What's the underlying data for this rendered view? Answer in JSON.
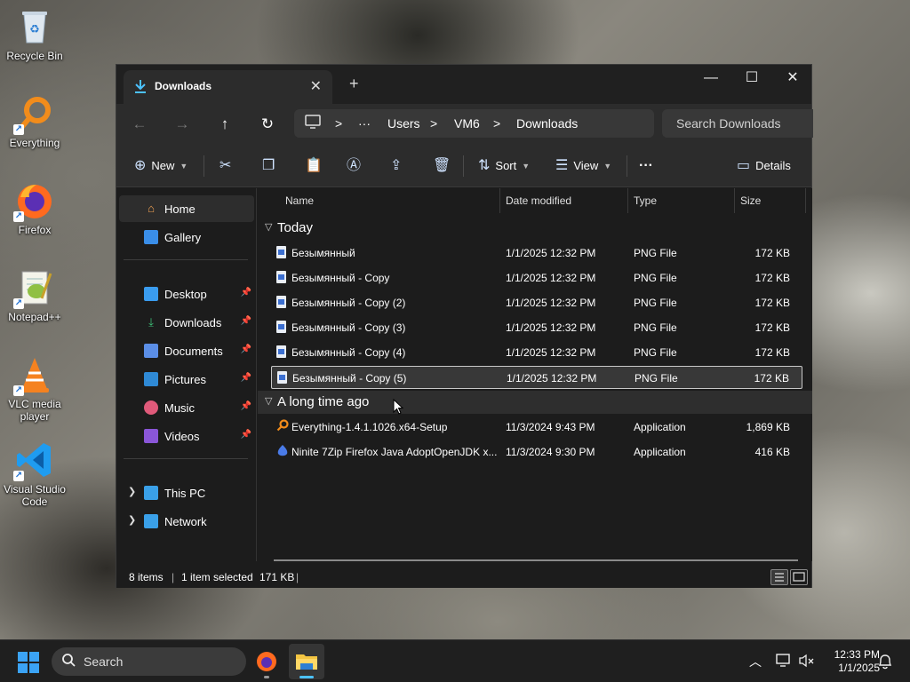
{
  "desktop": {
    "icons": [
      {
        "label": "Recycle Bin",
        "icon": "recycle-bin-icon"
      },
      {
        "label": "Everything",
        "icon": "everything-search-icon"
      },
      {
        "label": "Firefox",
        "icon": "firefox-icon"
      },
      {
        "label": "Notepad++",
        "icon": "notepadpp-icon"
      },
      {
        "label": "VLC media player",
        "icon": "vlc-icon"
      },
      {
        "label": "Visual Studio Code",
        "icon": "vscode-icon"
      }
    ]
  },
  "window": {
    "tab_title": "Downloads",
    "new_tab": "+",
    "controls": {
      "minimize": "—",
      "maximize": "☐",
      "close": "✕"
    }
  },
  "address": {
    "root_icon": "pc-icon",
    "ellipsis": "···",
    "crumbs": [
      "Users",
      "VM6",
      "Downloads"
    ],
    "separator": ">"
  },
  "search": {
    "placeholder": "Search Downloads"
  },
  "toolbar": {
    "new_label": "New",
    "sort_label": "Sort",
    "view_label": "View",
    "more_label": "···",
    "details_label": "Details"
  },
  "sidebar": {
    "top": [
      {
        "label": "Home",
        "icon": "home-icon"
      },
      {
        "label": "Gallery",
        "icon": "gallery-icon"
      }
    ],
    "pinned": [
      {
        "label": "Desktop",
        "icon": "desktop-folder-icon"
      },
      {
        "label": "Downloads",
        "icon": "downloads-folder-icon"
      },
      {
        "label": "Documents",
        "icon": "documents-folder-icon"
      },
      {
        "label": "Pictures",
        "icon": "pictures-folder-icon"
      },
      {
        "label": "Music",
        "icon": "music-folder-icon"
      },
      {
        "label": "Videos",
        "icon": "videos-folder-icon"
      }
    ],
    "drives": [
      {
        "label": "This PC",
        "icon": "this-pc-icon"
      },
      {
        "label": "Network",
        "icon": "network-icon"
      }
    ]
  },
  "columns": {
    "name": "Name",
    "date": "Date modified",
    "type": "Type",
    "size": "Size"
  },
  "groups": [
    {
      "title": "Today",
      "rows": [
        {
          "name": "Безымянный",
          "date": "1/1/2025 12:32 PM",
          "type": "PNG File",
          "size": "172 KB"
        },
        {
          "name": "Безымянный - Copy",
          "date": "1/1/2025 12:32 PM",
          "type": "PNG File",
          "size": "172 KB"
        },
        {
          "name": "Безымянный - Copy (2)",
          "date": "1/1/2025 12:32 PM",
          "type": "PNG File",
          "size": "172 KB"
        },
        {
          "name": "Безымянный - Copy (3)",
          "date": "1/1/2025 12:32 PM",
          "type": "PNG File",
          "size": "172 KB"
        },
        {
          "name": "Безымянный - Copy (4)",
          "date": "1/1/2025 12:32 PM",
          "type": "PNG File",
          "size": "172 KB"
        },
        {
          "name": "Безымянный - Copy (5)",
          "date": "1/1/2025 12:32 PM",
          "type": "PNG File",
          "size": "172 KB"
        }
      ]
    },
    {
      "title": "A long time ago",
      "rows": [
        {
          "name": "Everything-1.4.1.1026.x64-Setup",
          "date": "11/3/2024 9:43 PM",
          "type": "Application",
          "size": "1,869 KB"
        },
        {
          "name": "Ninite 7Zip Firefox Java AdoptOpenJDK x...",
          "date": "11/3/2024 9:30 PM",
          "type": "Application",
          "size": "416 KB"
        }
      ]
    }
  ],
  "status": {
    "items": "8 items",
    "selected": "1 item selected",
    "size": "171 KB"
  },
  "taskbar": {
    "search_label": "Search",
    "time": "12:33 PM",
    "date": "1/1/2025"
  },
  "colors": {
    "accent": "#0067c0",
    "selection_border": "#c8c8c8",
    "window_bg": "#1c1c1c"
  }
}
